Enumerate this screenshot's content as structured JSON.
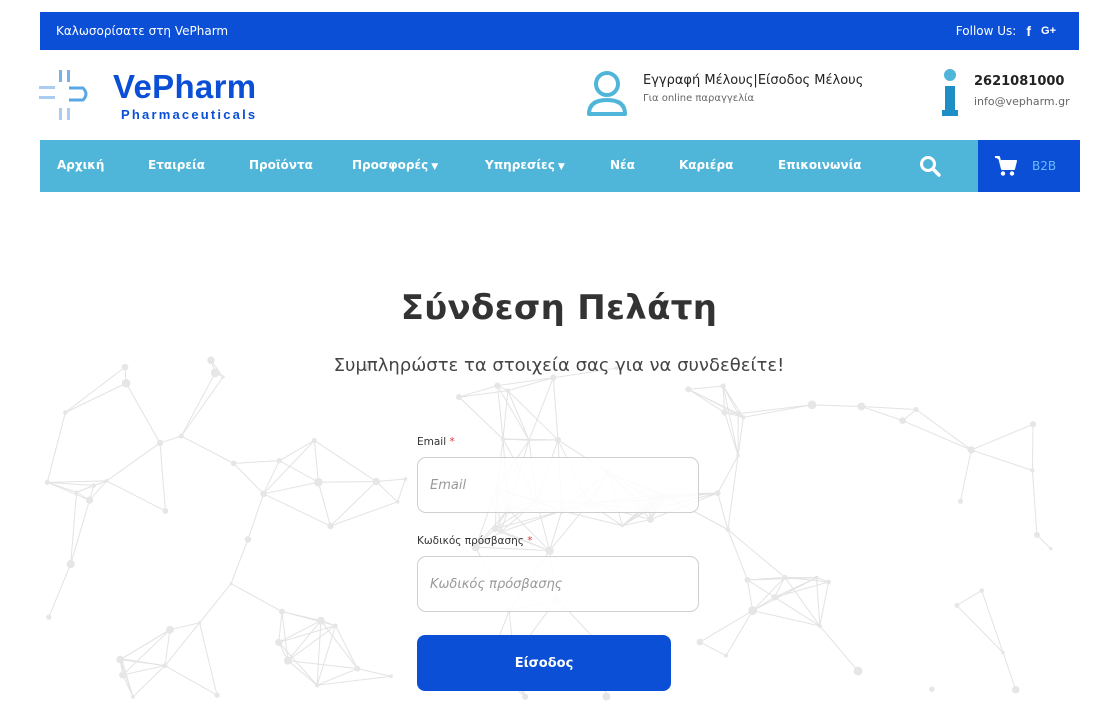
{
  "topbar": {
    "welcome": "Καλωσορίσατε στη VePharm",
    "follow_label": "Follow Us:",
    "facebook": "f",
    "googleplus": "G+"
  },
  "brand": {
    "name": "VePharm",
    "tagline": "Pharmaceuticals"
  },
  "member": {
    "register": "Εγγραφή Μέλους",
    "separator": "|",
    "login": "Είσοδος Μέλους",
    "subtitle": "Για online παραγγελία"
  },
  "contact": {
    "phone": "2621081000",
    "email": "info@vepharm.gr"
  },
  "nav": {
    "items": [
      {
        "label": "Αρχική"
      },
      {
        "label": "Εταιρεία"
      },
      {
        "label": "Προϊόντα"
      },
      {
        "label": "Προσφορές"
      },
      {
        "label": "Υπηρεσίες"
      },
      {
        "label": "Νέα"
      },
      {
        "label": "Καριέρα"
      },
      {
        "label": "Επικοινωνία"
      }
    ],
    "b2b_label": "B2B"
  },
  "login": {
    "title": "Σύνδεση Πελάτη",
    "subtitle": "Συμπληρώστε τα στοιχεία σας για να συνδεθείτε!",
    "email_label": "Email",
    "email_placeholder": "Email",
    "password_label": "Κωδικός πρόσβασης",
    "password_placeholder": "Κωδικός πρόσβασης",
    "required_mark": "*",
    "submit_label": "Είσοδος"
  },
  "colors": {
    "brand_blue": "#0a4fd6",
    "nav_cyan": "#4fb5d9"
  },
  "icons": {
    "member": "user-icon",
    "info": "info-icon",
    "search": "search-icon",
    "cart": "cart-icon"
  }
}
